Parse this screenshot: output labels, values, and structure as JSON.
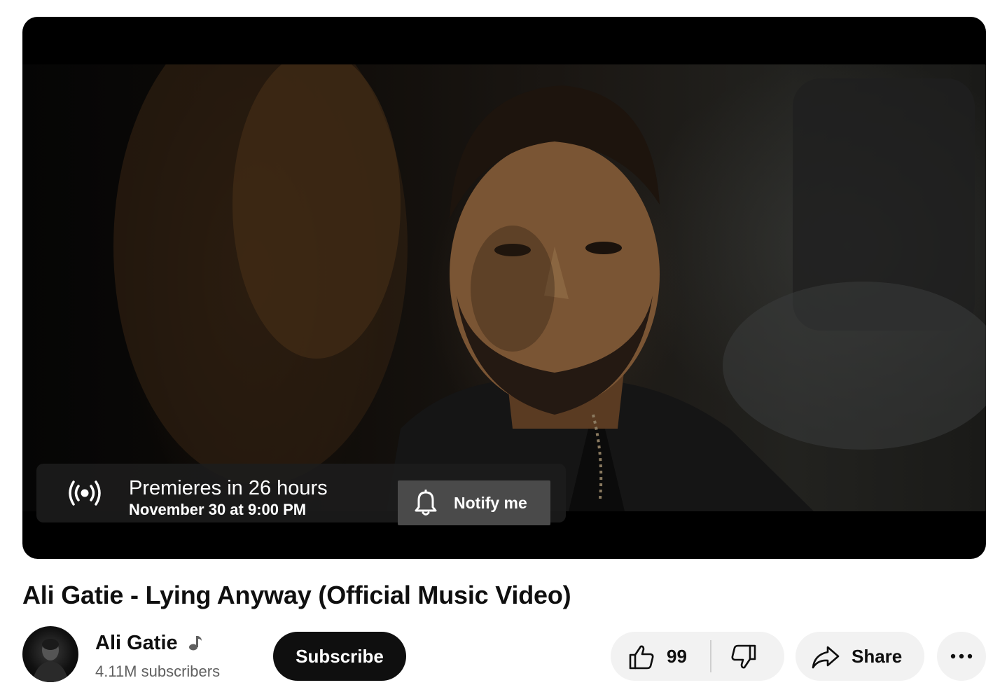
{
  "player": {
    "premiere_title": "Premieres in 26 hours",
    "premiere_date": "November 30 at 9:00 PM",
    "notify_label": "Notify me"
  },
  "video": {
    "title": "Ali Gatie - Lying Anyway (Official Music Video)"
  },
  "channel": {
    "name": "Ali Gatie",
    "subscribers": "4.11M subscribers",
    "subscribe_label": "Subscribe"
  },
  "actions": {
    "like_count": "99",
    "share_label": "Share"
  },
  "icons": {
    "live": "live-broadcast-icon",
    "bell": "bell-icon",
    "music": "music-note-icon",
    "like": "thumbs-up-icon",
    "dislike": "thumbs-down-icon",
    "share": "share-arrow-icon",
    "more": "more-horizontal-icon"
  },
  "colors": {
    "subscribe_bg": "#0f0f0f",
    "pill_bg": "#f2f2f2",
    "muted_text": "#606060"
  }
}
